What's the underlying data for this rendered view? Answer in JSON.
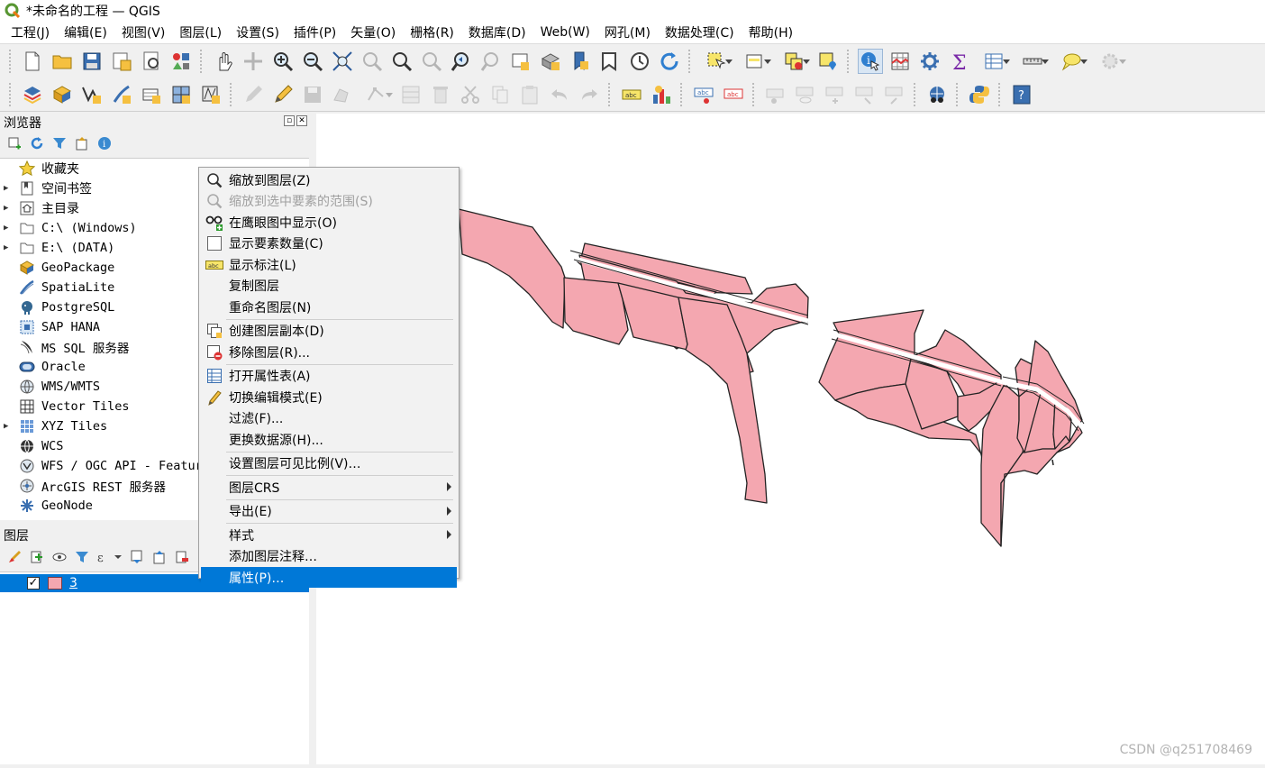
{
  "window": {
    "title": "*未命名的工程 — QGIS"
  },
  "menubar": {
    "items": [
      "工程(J)",
      "编辑(E)",
      "视图(V)",
      "图层(L)",
      "设置(S)",
      "插件(P)",
      "矢量(O)",
      "栅格(R)",
      "数据库(D)",
      "Web(W)",
      "网孔(M)",
      "数据处理(C)",
      "帮助(H)"
    ]
  },
  "browser": {
    "title": "浏览器",
    "items": [
      {
        "label": "收藏夹",
        "icon": "star-icon",
        "expandable": false
      },
      {
        "label": "空间书签",
        "icon": "bookmark-icon",
        "expandable": true
      },
      {
        "label": "主目录",
        "icon": "home-icon",
        "expandable": true
      },
      {
        "label": "C:\\ (Windows)",
        "icon": "folder-icon",
        "expandable": true
      },
      {
        "label": "E:\\ (DATA)",
        "icon": "folder-icon",
        "expandable": true
      },
      {
        "label": "GeoPackage",
        "icon": "geopackage-icon",
        "expandable": false
      },
      {
        "label": "SpatiaLite",
        "icon": "spatialite-icon",
        "expandable": false
      },
      {
        "label": "PostgreSQL",
        "icon": "postgresql-icon",
        "expandable": false
      },
      {
        "label": "SAP HANA",
        "icon": "sap-hana-icon",
        "expandable": false
      },
      {
        "label": "MS SQL 服务器",
        "icon": "mssql-icon",
        "expandable": false
      },
      {
        "label": "Oracle",
        "icon": "oracle-icon",
        "expandable": false
      },
      {
        "label": "WMS/WMTS",
        "icon": "wms-icon",
        "expandable": false
      },
      {
        "label": "Vector Tiles",
        "icon": "vector-tiles-icon",
        "expandable": false
      },
      {
        "label": "XYZ Tiles",
        "icon": "xyz-tiles-icon",
        "expandable": true
      },
      {
        "label": "WCS",
        "icon": "wcs-icon",
        "expandable": false
      },
      {
        "label": "WFS / OGC API - Features",
        "icon": "wfs-icon",
        "expandable": false
      },
      {
        "label": "ArcGIS REST 服务器",
        "icon": "arcgis-icon",
        "expandable": false
      },
      {
        "label": "GeoNode",
        "icon": "geonode-icon",
        "expandable": false
      }
    ]
  },
  "layers": {
    "title": "图层",
    "items": [
      {
        "name": "3",
        "checked": true,
        "fill": "#f4a7b0",
        "selected": true
      }
    ]
  },
  "context_menu": {
    "items": [
      {
        "label": "缩放到图层(Z)",
        "icon": "zoom-layer-icon",
        "disabled": false
      },
      {
        "label": "缩放到选中要素的范围(S)",
        "icon": "zoom-selection-icon",
        "disabled": true
      },
      {
        "label": "在鹰眼图中显示(O)",
        "icon": "overview-icon",
        "disabled": false
      },
      {
        "label": "显示要素数量(C)",
        "icon": "checkbox-icon",
        "disabled": false
      },
      {
        "label": "显示标注(L)",
        "icon": "label-icon",
        "disabled": false
      },
      {
        "label": "复制图层",
        "icon": "",
        "disabled": false
      },
      {
        "label": "重命名图层(N)",
        "icon": "",
        "disabled": false
      },
      {
        "label": "创建图层副本(D)",
        "icon": "duplicate-layer-icon",
        "disabled": false
      },
      {
        "label": "移除图层(R)...",
        "icon": "remove-layer-icon",
        "disabled": false
      },
      {
        "label": "打开属性表(A)",
        "icon": "attribute-table-icon",
        "disabled": false
      },
      {
        "label": "切换编辑模式(E)",
        "icon": "pencil-icon",
        "disabled": false
      },
      {
        "label": "过滤(F)...",
        "icon": "",
        "disabled": false
      },
      {
        "label": "更换数据源(H)...",
        "icon": "",
        "disabled": false
      },
      {
        "label": "设置图层可见比例(V)…",
        "icon": "",
        "disabled": false
      },
      {
        "label": "图层CRS",
        "icon": "",
        "disabled": false,
        "submenu": true
      },
      {
        "label": "导出(E)",
        "icon": "",
        "disabled": false,
        "submenu": true
      },
      {
        "label": "样式",
        "icon": "",
        "disabled": false,
        "submenu": true
      },
      {
        "label": "添加图层注释…",
        "icon": "",
        "disabled": false
      },
      {
        "label": "属性(P)…",
        "icon": "",
        "disabled": false,
        "highlighted": true
      }
    ]
  },
  "map": {
    "feature_fill": "#f4a7b0",
    "feature_stroke": "#232323"
  },
  "watermark": "CSDN @q251708469"
}
